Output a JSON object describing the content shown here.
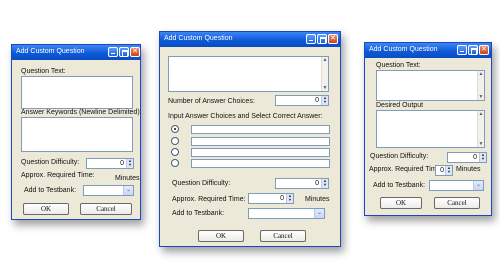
{
  "left_window": {
    "title": "Add Custom Question",
    "question_text_label": "Question Text:",
    "answer_keywords_label": "Answer Keywords (Newline Delimited):",
    "difficulty_label": "Question Difficulty:",
    "difficulty_value": "0",
    "time_label": "Approx. Required Time:",
    "time_unit": "Minutes",
    "testbank_label": "Add to Testbank:",
    "ok_label": "OK",
    "cancel_label": "Cancel"
  },
  "middle_window": {
    "title": "Add Custom Question",
    "num_choices_label": "Number of Answer Choices:",
    "num_choices_value": "0",
    "instructions_label": "Input Answer Choices and Select Correct Answer:",
    "choices": [
      {
        "selected": true,
        "value": ""
      },
      {
        "selected": false,
        "value": ""
      },
      {
        "selected": false,
        "value": ""
      },
      {
        "selected": false,
        "value": ""
      }
    ],
    "difficulty_label": "Question Difficulty:",
    "difficulty_value": "0",
    "time_label": "Approx. Required Time:",
    "time_value": "0",
    "time_unit": "Minutes",
    "testbank_label": "Add to Testbank:",
    "ok_label": "OK",
    "cancel_label": "Cancel"
  },
  "right_window": {
    "title": "Add Custom Question",
    "question_text_label": "Question Text:",
    "desired_output_label": "Desired Output",
    "difficulty_label": "Question Difficulty:",
    "difficulty_value": "0",
    "time_label": "Approx. Required Time:",
    "time_value": "0",
    "time_unit": "Minutes",
    "testbank_label": "Add to Testbank:",
    "ok_label": "OK",
    "cancel_label": "Cancel"
  },
  "icons": {
    "minimize": "minimize-icon",
    "maximize": "maximize-icon",
    "close": "close-icon",
    "scroll_up": "scroll-up-icon",
    "scroll_down": "scroll-down-icon",
    "dropdown": "chevron-down-icon"
  },
  "colors": {
    "title_bar": "#0d5ad8",
    "window_face": "#ece9d8",
    "field_border": "#7f9db9",
    "close_button": "#c9431c"
  }
}
